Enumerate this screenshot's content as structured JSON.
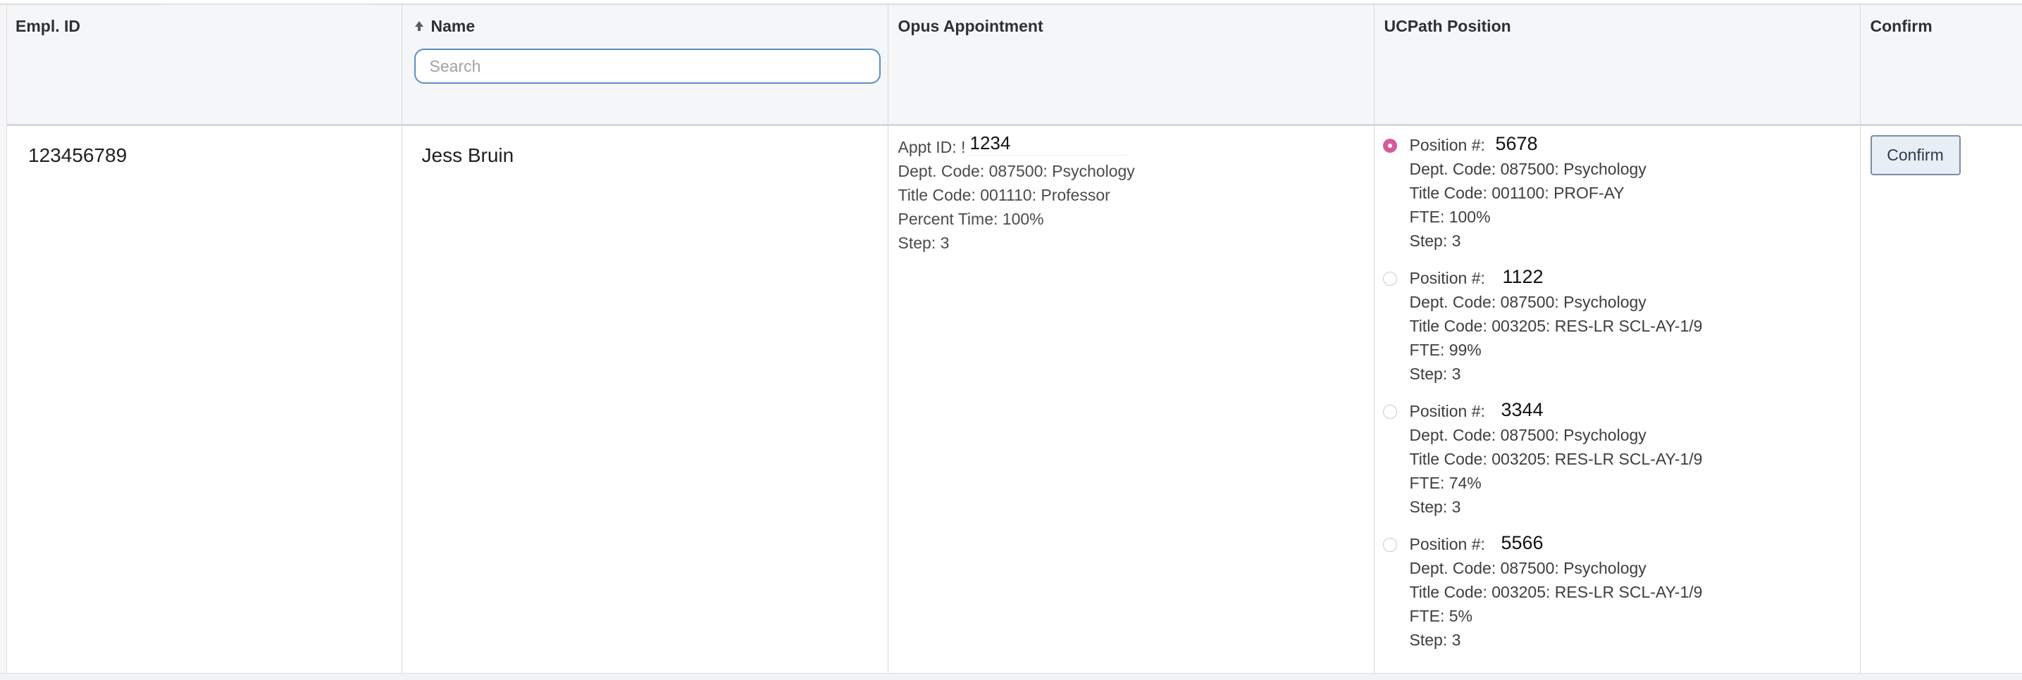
{
  "columns": {
    "empl_id": "Empl. ID",
    "name": "Name",
    "opus": "Opus Appointment",
    "ucpath": "UCPath Position",
    "confirm": "Confirm"
  },
  "search": {
    "placeholder": "Search",
    "value": ""
  },
  "sort": {
    "column": "Name",
    "direction": "ascending",
    "icon": "arrow-up-icon"
  },
  "row": {
    "empl_id": "123456789",
    "name": "Jess Bruin",
    "opus": {
      "appt_id_label": "Appt ID: !",
      "appt_id_value": "1234",
      "dept": "Dept. Code: 087500: Psychology",
      "title": "Title Code: 001110: Professor",
      "percent": "Percent Time: 100%",
      "step": "Step: 3"
    },
    "positions": [
      {
        "label": "Position #:",
        "number": "5678",
        "dept": "Dept. Code: 087500: Psychology",
        "title": "Title Code: 001100: PROF-AY",
        "fte": "FTE: 100%",
        "step": "Step: 3",
        "selected": true
      },
      {
        "label": "Position #:",
        "number": "1122",
        "dept": "Dept. Code: 087500: Psychology",
        "title": "Title Code: 003205: RES-LR SCL-AY-1/9",
        "fte": "FTE: 99%",
        "step": "Step: 3",
        "selected": false
      },
      {
        "label": "Position #:",
        "number": "3344",
        "dept": "Dept. Code: 087500: Psychology",
        "title": "Title Code: 003205: RES-LR SCL-AY-1/9",
        "fte": "FTE: 74%",
        "step": "Step: 3",
        "selected": false
      },
      {
        "label": "Position #:",
        "number": "5566",
        "dept": "Dept. Code: 087500: Psychology",
        "title": "Title Code: 003205: RES-LR SCL-AY-1/9",
        "fte": "FTE: 5%",
        "step": "Step: 3",
        "selected": false
      }
    ],
    "confirm_label": "Confirm"
  },
  "colors": {
    "radio_selected": "#d65b9e",
    "search_border": "#5b8fc7",
    "confirm_bg": "#e7eef5",
    "confirm_border": "#7b8da3",
    "header_bg": "#f5f6f7"
  }
}
